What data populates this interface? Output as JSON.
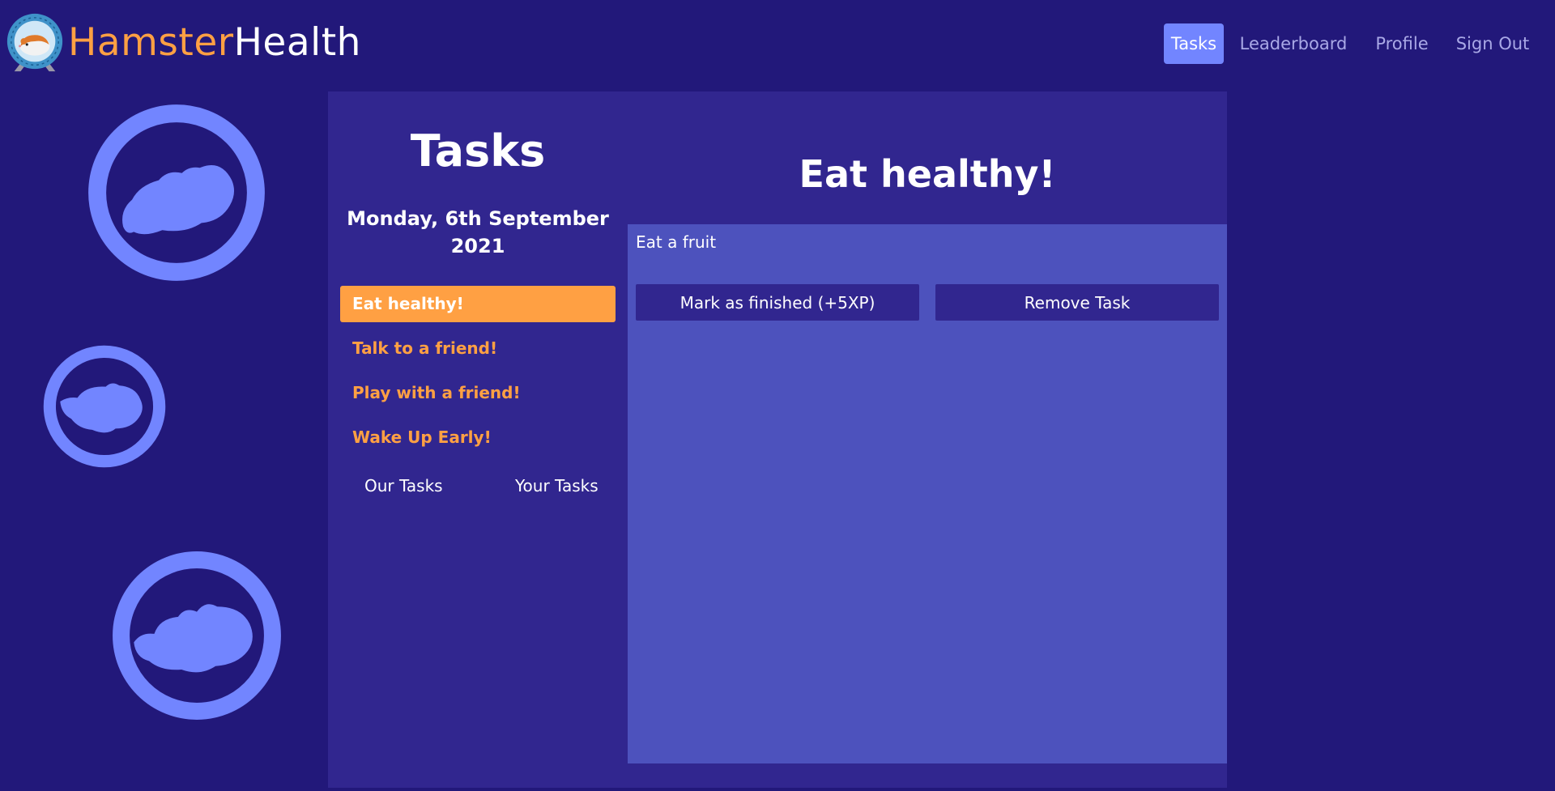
{
  "brand": {
    "part1": "Hamster",
    "part2": "Health"
  },
  "nav": {
    "items": [
      {
        "label": "Tasks",
        "active": true
      },
      {
        "label": "Leaderboard"
      },
      {
        "label": "Profile"
      },
      {
        "label": "Sign Out"
      }
    ]
  },
  "tasks_panel": {
    "heading": "Tasks",
    "date_line1": "Monday, 6th September",
    "date_line2": "2021",
    "items": [
      {
        "label": "Eat healthy!",
        "active": true
      },
      {
        "label": "Talk to a friend!"
      },
      {
        "label": "Play with a friend!"
      },
      {
        "label": "Wake Up Early!"
      }
    ],
    "tabs": [
      "Our Tasks",
      "Your Tasks"
    ]
  },
  "detail": {
    "title": "Eat healthy!",
    "description": "Eat a fruit",
    "finish_button": "Mark as finished (+5XP)",
    "remove_button": "Remove Task"
  },
  "colors": {
    "background": "#22187a",
    "panel": "#31268f",
    "detail_box": "#4d52bd",
    "accent_orange": "#ffa043",
    "accent_blue": "#7285ff",
    "nav_inactive": "#a9a8e6"
  },
  "icons": {
    "logo": "hamster-wheel-logo-icon",
    "decor": "hamster-wheel-icon"
  }
}
